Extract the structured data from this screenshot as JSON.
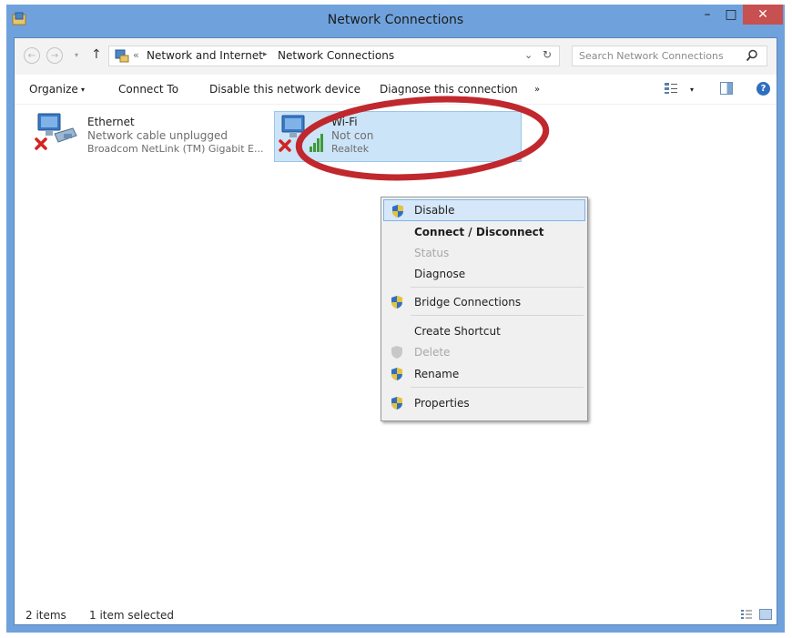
{
  "window": {
    "title": "Network Connections",
    "minimize": "–",
    "maximize": "□",
    "close": "✕"
  },
  "address": {
    "back": "←",
    "forward": "→",
    "recent": "▾",
    "up": "↑",
    "crumb_prefix": "«",
    "crumbs": [
      "Network and Internet",
      "Network Connections"
    ],
    "crumb_arrow": "▸",
    "dropdown": "⌄",
    "refresh": "↻"
  },
  "search": {
    "placeholder": "Search Network Connections"
  },
  "commands": {
    "organize": "Organize",
    "organize_arrow": "▾",
    "connect_to": "Connect To",
    "disable_device": "Disable this network device",
    "diagnose": "Diagnose this connection",
    "more": "»",
    "view_arrow": "▾",
    "help": "?"
  },
  "items": [
    {
      "name": "Ethernet",
      "status": "Network cable unplugged",
      "device": "Broadcom NetLink (TM) Gigabit E..."
    },
    {
      "name": "Wi-Fi",
      "status": "Not con",
      "device": "Realtek"
    }
  ],
  "context_menu": {
    "items": [
      {
        "label": "Disable"
      },
      {
        "label": "Connect / Disconnect"
      },
      {
        "label": "Status"
      },
      {
        "label": "Diagnose"
      },
      {
        "label": "Bridge Connections"
      },
      {
        "label": "Create Shortcut"
      },
      {
        "label": "Delete"
      },
      {
        "label": "Rename"
      },
      {
        "label": "Properties"
      }
    ]
  },
  "status": {
    "count": "2 items",
    "selected": "1 item selected"
  },
  "colors": {
    "frame": "#6fa2dc",
    "selection": "#cce4f7",
    "annotation": "#c0282d",
    "close": "#c75050"
  }
}
